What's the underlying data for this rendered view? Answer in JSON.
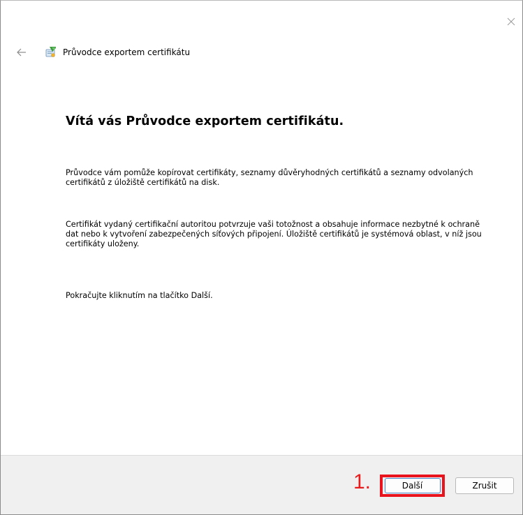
{
  "window": {
    "close_icon": "close-icon"
  },
  "header": {
    "back_icon": "back-arrow-icon",
    "wizard_icon": "certificate-wizard-icon",
    "title": "Průvodce exportem certifikátu"
  },
  "content": {
    "heading": "Vítá vás Průvodce exportem certifikátu.",
    "paragraph1": "Průvodce vám pomůže kopírovat certifikáty, seznamy důvěryhodných certifikátů a seznamy odvolaných certifikátů z úložiště certifikátů na disk.",
    "paragraph2": "Certifikát vydaný certifikační autoritou potvrzuje vaši totožnost a obsahuje informace nezbytné k ochraně dat nebo k vytvoření zabezpečených síťových připojení. Úložiště certifikátů je systémová oblast, v níž jsou certifikáty uloženy.",
    "paragraph3": "Pokračujte kliknutím na tlačítko Další."
  },
  "footer": {
    "step_annotation": "1.",
    "next_label": "Další",
    "cancel_label": "Zrušit",
    "highlight_color": "#e8131d"
  }
}
